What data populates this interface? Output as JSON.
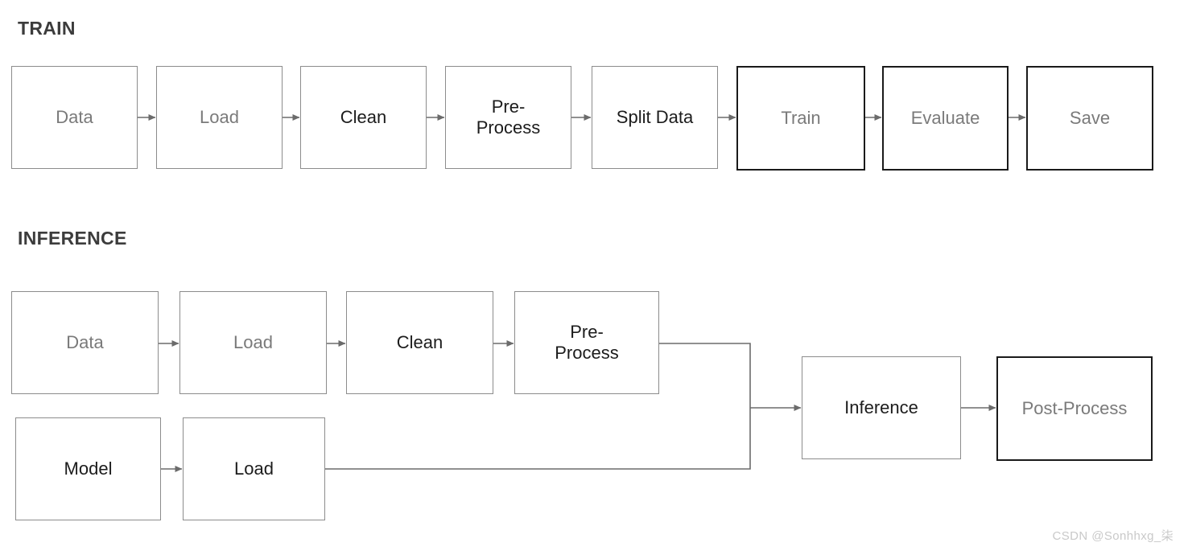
{
  "theme": {
    "background": "#ffffff",
    "border_light": "#8c8c8c",
    "border_dark": "#1a1a1a",
    "text_grey": "#7a7a7a",
    "text_dark": "#1c1c1c",
    "arrow_color": "#6b6b6b",
    "watermark_color": "#c9c9c9",
    "title_color": "#3c3c3c"
  },
  "sections": {
    "train": {
      "title": "TRAIN"
    },
    "inference": {
      "title": "INFERENCE"
    }
  },
  "train_pipeline": {
    "nodes": [
      {
        "label": "Data",
        "border": "light",
        "text": "grey"
      },
      {
        "label": "Load",
        "border": "light",
        "text": "grey"
      },
      {
        "label": "Clean",
        "border": "light",
        "text": "dark"
      },
      {
        "label": "Pre-\nProcess",
        "border": "light",
        "text": "dark"
      },
      {
        "label": "Split Data",
        "border": "light",
        "text": "dark"
      },
      {
        "label": "Train",
        "border": "dark",
        "text": "grey"
      },
      {
        "label": "Evaluate",
        "border": "dark",
        "text": "grey"
      },
      {
        "label": "Save",
        "border": "dark",
        "text": "grey"
      }
    ]
  },
  "inference_pipeline": {
    "data_row": [
      {
        "label": "Data",
        "border": "light",
        "text": "grey"
      },
      {
        "label": "Load",
        "border": "light",
        "text": "grey"
      },
      {
        "label": "Clean",
        "border": "light",
        "text": "dark"
      },
      {
        "label": "Pre-\nProcess",
        "border": "light",
        "text": "dark"
      }
    ],
    "model_row": [
      {
        "label": "Model",
        "border": "light",
        "text": "dark"
      },
      {
        "label": "Load",
        "border": "light",
        "text": "dark"
      }
    ],
    "output_row": [
      {
        "label": "Inference",
        "border": "light",
        "text": "dark"
      },
      {
        "label": "Post-Process",
        "border": "dark",
        "text": "grey"
      }
    ]
  },
  "watermark": {
    "text": "CSDN @Sonhhxg_柒"
  }
}
